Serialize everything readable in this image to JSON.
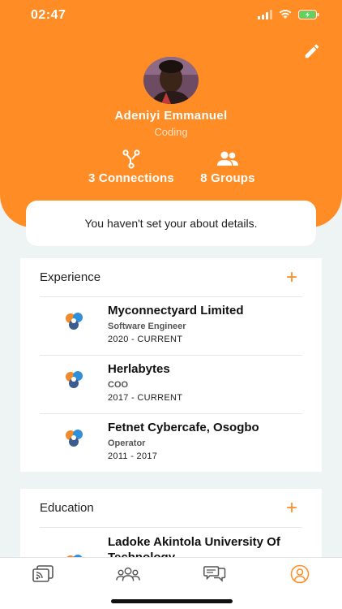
{
  "status": {
    "time": "02:47"
  },
  "profile": {
    "name": "Adeniyi Emmanuel",
    "tagline": "Coding",
    "connections_label": "3 Connections",
    "groups_label": "8 Groups"
  },
  "about": {
    "text": "You haven't set your about details."
  },
  "experience": {
    "title": "Experience",
    "add_label": "+",
    "items": [
      {
        "company": "Myconnectyard Limited",
        "role": "Software Engineer",
        "dates": "2020 - CURRENT"
      },
      {
        "company": "Herlabytes",
        "role": "COO",
        "dates": "2017 - CURRENT"
      },
      {
        "company": "Fetnet Cybercafe, Osogbo",
        "role": "Operator",
        "dates": "2011 - 2017"
      }
    ]
  },
  "education": {
    "title": "Education",
    "add_label": "+",
    "items": [
      {
        "school": "Ladoke Akintola University Of Technology"
      }
    ]
  },
  "tabs": [
    {
      "icon": "feed-icon",
      "active": false
    },
    {
      "icon": "people-icon",
      "active": false
    },
    {
      "icon": "chat-icon",
      "active": false
    },
    {
      "icon": "profile-icon",
      "active": true
    }
  ],
  "colors": {
    "accent": "#ff8c24",
    "background": "#eef3f4",
    "card": "#ffffff"
  }
}
